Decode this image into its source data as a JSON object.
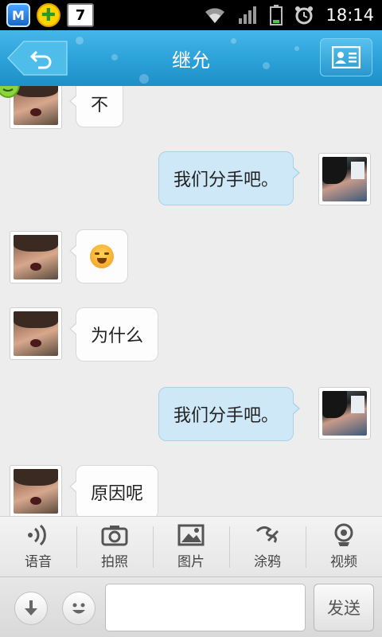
{
  "status_bar": {
    "time": "18:14",
    "notifications": [
      {
        "icon": "security-shield-icon",
        "text": "M"
      },
      {
        "icon": "plus-app-icon",
        "text": "✚"
      },
      {
        "icon": "calendar-icon",
        "text": "7"
      }
    ],
    "icons": [
      "wifi-icon",
      "signal-icon",
      "battery-icon",
      "alarm-icon"
    ]
  },
  "header": {
    "title": "继允",
    "back_icon": "back-arrow-icon",
    "profile_icon": "contact-card-icon",
    "accent": "#2ba1d9"
  },
  "messages": [
    {
      "side": "in",
      "type": "text",
      "text": "不"
    },
    {
      "side": "out",
      "type": "text",
      "text": "我们分手吧。"
    },
    {
      "side": "in",
      "type": "emoji",
      "emoji": "crying-laughing-emoji"
    },
    {
      "side": "in",
      "type": "text",
      "text": "为什么"
    },
    {
      "side": "out",
      "type": "text",
      "text": "我们分手吧。"
    },
    {
      "side": "in",
      "type": "text",
      "text": "原因呢"
    }
  ],
  "toolbar": {
    "items": [
      {
        "icon": "voice-icon",
        "label": "语音"
      },
      {
        "icon": "camera-icon",
        "label": "拍照"
      },
      {
        "icon": "picture-icon",
        "label": "图片"
      },
      {
        "icon": "doodle-icon",
        "label": "涂鸦"
      },
      {
        "icon": "webcam-icon",
        "label": "视频"
      }
    ]
  },
  "input_bar": {
    "placeholder": "",
    "value": "",
    "send_label": "发送",
    "left_icons": [
      "collapse-down-icon",
      "smiley-icon"
    ]
  }
}
